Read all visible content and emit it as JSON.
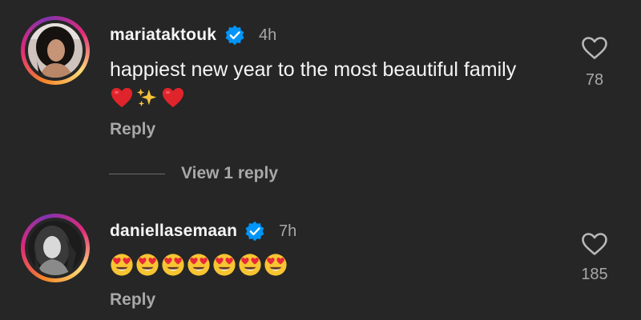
{
  "comments": [
    {
      "username": "mariataktouk",
      "verified": true,
      "time": "4h",
      "text": "happiest new year to the most beautiful family",
      "emojis": [
        "red-heart",
        "sparkles",
        "red-heart"
      ],
      "reply_label": "Reply",
      "likes": "78",
      "view_replies_label": "View 1 reply"
    },
    {
      "username": "daniellasemaan",
      "verified": true,
      "time": "7h",
      "text": "",
      "emojis": [
        "heart-eyes",
        "heart-eyes",
        "heart-eyes",
        "heart-eyes",
        "heart-eyes",
        "heart-eyes",
        "heart-eyes"
      ],
      "reply_label": "Reply",
      "likes": "185"
    }
  ],
  "colors": {
    "background": "#262626",
    "primary_text": "#f5f5f5",
    "secondary_text": "#a8a8a8",
    "verified_blue": "#0095f6"
  }
}
